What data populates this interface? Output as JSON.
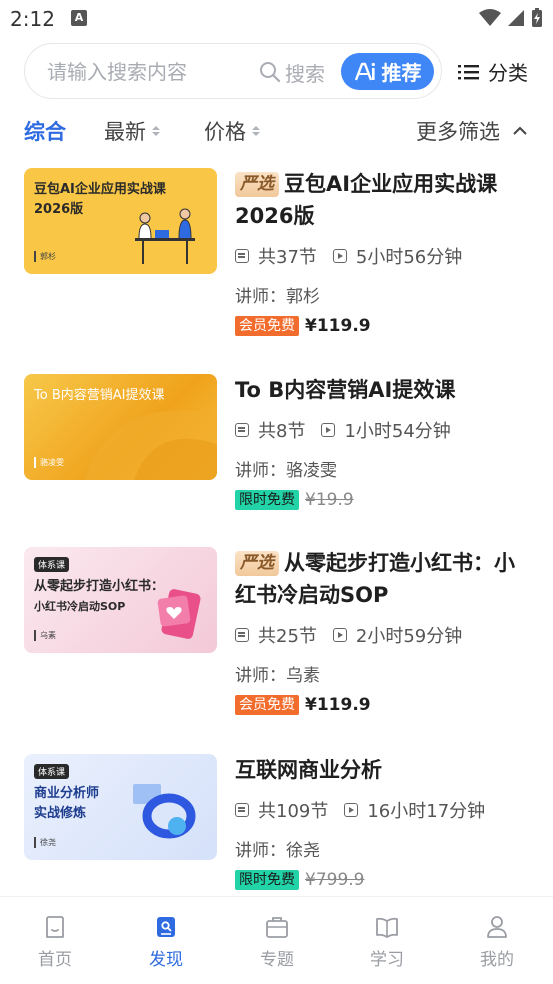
{
  "status_bar": {
    "time": "2:12",
    "notif_icon": "A"
  },
  "search": {
    "placeholder": "请输入搜索内容",
    "search_label": "搜索",
    "recommend_label": "推荐",
    "category_label": "分类"
  },
  "filters": {
    "items": [
      "综合",
      "最新",
      "价格"
    ],
    "more": "更多筛选",
    "active": "综合"
  },
  "colors": {
    "accent": "#2f6be0",
    "recommend_bg": "#3f86f7",
    "member_badge": "#f26c2d",
    "limited_badge": "#22d3a7"
  },
  "courses": [
    {
      "tag": "严选",
      "title": "豆包AI企业应用实战课2026版",
      "lessons": "共37节",
      "duration": "5小时56分钟",
      "lecturer": "讲师：郭杉",
      "badge": "会员免费",
      "price": "¥119.9",
      "price_struck": false,
      "thumb": {
        "title_line1": "豆包AI企业应用实战课",
        "title_line2": "2026版",
        "author": "郭杉",
        "bg": "#f9c646"
      }
    },
    {
      "tag": "",
      "title": "To B内容营销AI提效课",
      "lessons": "共8节",
      "duration": "1小时54分钟",
      "lecturer": "讲师：骆凌雯",
      "badge": "限时免费",
      "price": "¥19.9",
      "price_struck": true,
      "thumb": {
        "title_line1": "To B内容营销AI提效课",
        "author": "骆凌雯",
        "bg": "#f4b52a"
      }
    },
    {
      "tag": "严选",
      "title": "从零起步打造小红书：小红书冷启动SOP",
      "lessons": "共25节",
      "duration": "2小时59分钟",
      "lecturer": "讲师：乌素",
      "badge": "会员免费",
      "price": "¥119.9",
      "price_struck": false,
      "thumb": {
        "series": "体系课",
        "title_line1": "从零起步打造小红书：",
        "title_line2": "小红书冷启动SOP",
        "author": "乌素",
        "bg": "#f7dbe4"
      }
    },
    {
      "tag": "",
      "title": "互联网商业分析",
      "lessons": "共109节",
      "duration": "16小时17分钟",
      "lecturer": "讲师：徐尧",
      "badge": "限时免费",
      "price": "¥799.9",
      "price_struck": true,
      "thumb": {
        "series": "体系课",
        "title_line1": "商业分析师",
        "title_line2": "实战修炼",
        "author": "徐尧",
        "bg": "#dfe8fb"
      }
    }
  ],
  "tab_bar": {
    "items": [
      {
        "label": "首页",
        "icon": "home-icon"
      },
      {
        "label": "发现",
        "icon": "discover-icon"
      },
      {
        "label": "专题",
        "icon": "topic-icon"
      },
      {
        "label": "学习",
        "icon": "book-icon"
      },
      {
        "label": "我的",
        "icon": "user-icon"
      }
    ],
    "active": "发现"
  }
}
